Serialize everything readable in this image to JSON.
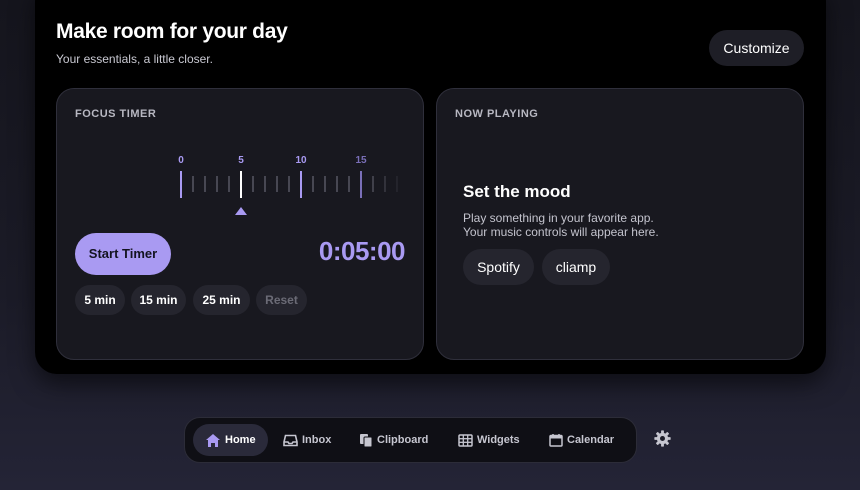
{
  "header": {
    "title": "Make room for your day",
    "subtitle": "Your essentials, a little closer.",
    "customize_label": "Customize"
  },
  "focus_timer": {
    "label": "FOCUS TIMER",
    "ruler_labels": [
      "0",
      "5",
      "10",
      "15"
    ],
    "selected_minutes": 5,
    "start_label": "Start Timer",
    "display": "0:05:00",
    "presets": [
      "5 min",
      "15 min",
      "25 min"
    ],
    "reset_label": "Reset",
    "accent_color": "#a99af2"
  },
  "now_playing": {
    "label": "NOW PLAYING",
    "title": "Set the mood",
    "desc_line1": "Play something in your favorite app.",
    "desc_line2": "Your music controls will appear here.",
    "apps": [
      "Spotify",
      "cliamp"
    ]
  },
  "nav": {
    "items": [
      {
        "label": "Home",
        "icon": "home-icon",
        "active": true
      },
      {
        "label": "Inbox",
        "icon": "inbox-icon",
        "active": false
      },
      {
        "label": "Clipboard",
        "icon": "clipboard-icon",
        "active": false
      },
      {
        "label": "Widgets",
        "icon": "widgets-icon",
        "active": false
      },
      {
        "label": "Calendar",
        "icon": "calendar-icon",
        "active": false
      }
    ],
    "settings_icon": "gear-icon"
  }
}
